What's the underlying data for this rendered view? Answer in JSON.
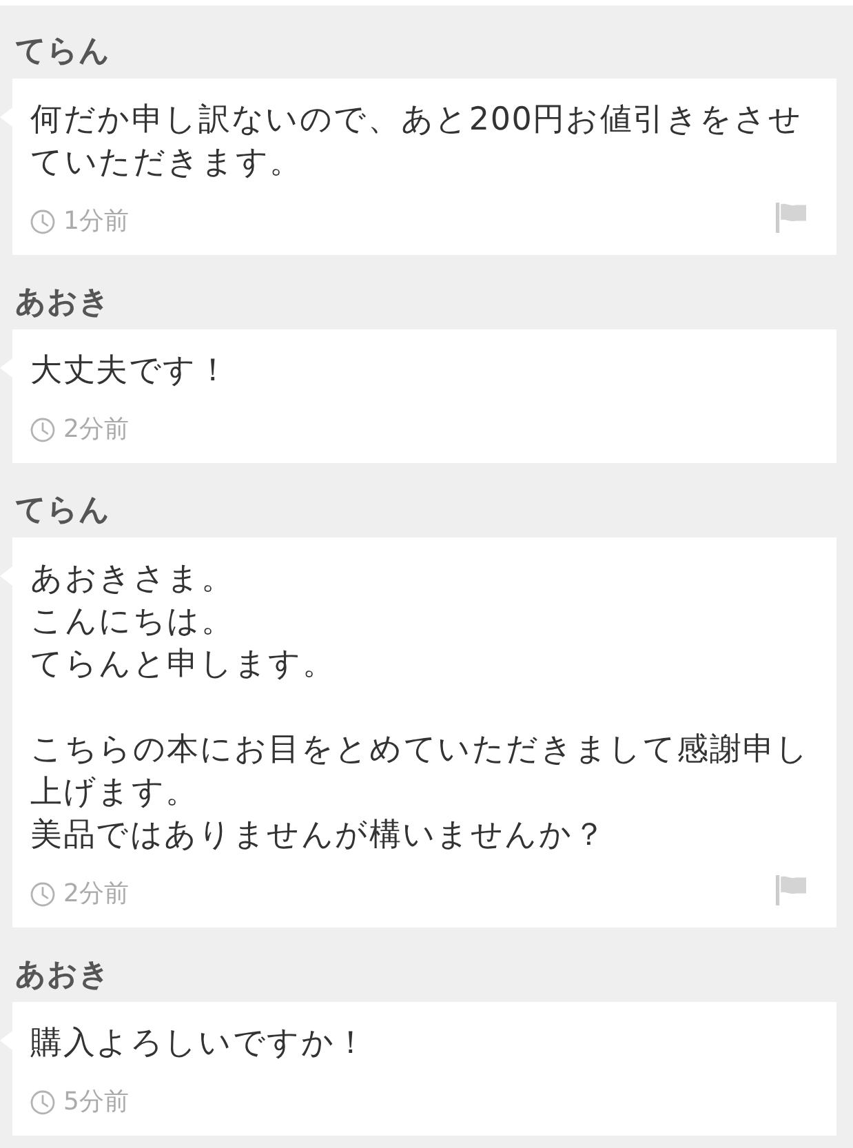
{
  "messages": [
    {
      "sender": "てらん",
      "paragraphs": [
        [
          "何だか申し訳ないので、あと200円お値引きをさせていただきます。"
        ]
      ],
      "time": "1分前",
      "flag": true
    },
    {
      "sender": "あおき",
      "paragraphs": [
        [
          "大丈夫です！"
        ]
      ],
      "time": "2分前",
      "flag": false
    },
    {
      "sender": "てらん",
      "paragraphs": [
        [
          "あおきさま。",
          "こんにちは。",
          "てらんと申します。"
        ],
        [
          "こちらの本にお目をとめていただきまして感謝申し上げます。",
          "美品ではありませんが構いませんか？"
        ]
      ],
      "time": "2分前",
      "flag": true
    },
    {
      "sender": "あおき",
      "paragraphs": [
        [
          "購入よろしいですか！"
        ]
      ],
      "time": "5分前",
      "flag": false
    }
  ]
}
